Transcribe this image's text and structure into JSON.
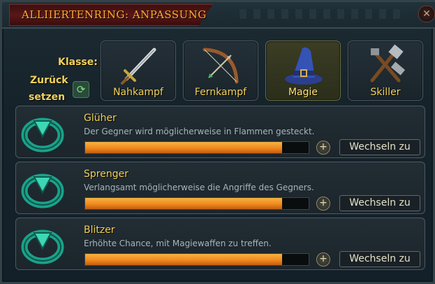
{
  "window": {
    "title": "Alliiertenring: Anpassung"
  },
  "labels": {
    "class": "Klasse:",
    "reset_line1": "Zurück",
    "reset_line2": "setzen"
  },
  "classes": [
    {
      "label": "Nahkampf",
      "icon": "sword-icon",
      "selected": false
    },
    {
      "label": "Fernkampf",
      "icon": "bow-icon",
      "selected": false
    },
    {
      "label": "Magie",
      "icon": "wizard-hat-icon",
      "selected": true
    },
    {
      "label": "Skiller",
      "icon": "tools-icon",
      "selected": false
    }
  ],
  "rings": [
    {
      "name": "Glüher",
      "description": "Der Gegner wird möglicherweise in Flammen gesteckt.",
      "progress": 0.88,
      "button": "Wechseln zu",
      "icon": "ring-icon"
    },
    {
      "name": "Sprenger",
      "description": "Verlangsamt möglicherweise die Angriffe des Gegners.",
      "progress": 0.88,
      "button": "Wechseln zu",
      "icon": "ring-icon"
    },
    {
      "name": "Blitzer",
      "description": "Erhöhte Chance, mit Magiewaffen zu treffen.",
      "progress": 0.88,
      "button": "Wechseln zu",
      "icon": "ring-icon"
    }
  ],
  "colors": {
    "accent": "#f3d25a",
    "title": "#ffb02a",
    "progress": "#f0891e"
  }
}
